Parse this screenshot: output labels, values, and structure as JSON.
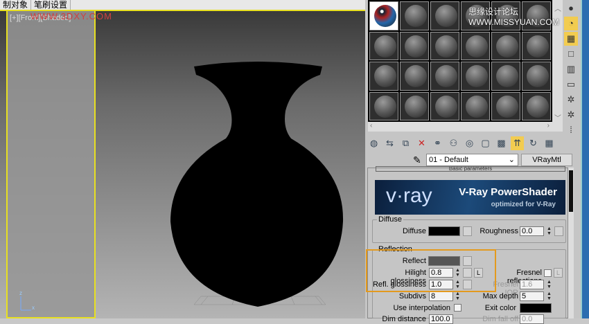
{
  "menubar": {
    "items": [
      "制对象",
      "笔刷设置"
    ]
  },
  "viewport": {
    "label": "[+][Front][Shaded]",
    "watermark": "WWW.3DXY.COM"
  },
  "watermark2": "思缘设计论坛 WWW.MISSYUAN.COM",
  "material_editor": {
    "slot_count": 24,
    "active_slot": 0,
    "side_icons": [
      "sample-type-icon",
      "backlight-icon",
      "background-icon",
      "uv-tiling-icon",
      "video-color-check-icon",
      "make-preview-icon",
      "options-icon",
      "select-by-material-icon",
      "material-map-navigator-icon"
    ],
    "toolbar_icons": [
      "get-material-icon",
      "put-to-scene-icon",
      "assign-to-selection-icon",
      "reset-map-icon",
      "make-unique-icon",
      "put-to-library-icon",
      "material-id-icon",
      "show-map-icon",
      "show-end-result-icon",
      "go-to-parent-icon",
      "go-forward-icon",
      "background-icon"
    ],
    "material_name": "01 - Default",
    "material_type": "VRayMtl",
    "rollout_title": "Basic parameters",
    "banner": {
      "logo": "v·ray",
      "title": "V-Ray PowerShader",
      "subtitle": "optimized for V-Ray"
    },
    "diffuse": {
      "group": "Diffuse",
      "label": "Diffuse",
      "color": "#000000",
      "roughness_label": "Roughness",
      "roughness": "0.0"
    },
    "reflection": {
      "group": "Reflection",
      "reflect_label": "Reflect",
      "reflect_color": "#555555",
      "hilight_label": "Hilight glossiness",
      "hilight": "0.8",
      "lock": "L",
      "refl_gloss_label": "Refl. glossiness",
      "refl_gloss": "1.0",
      "fresnel_label": "Fresnel reflections",
      "fresnel_lock": "L",
      "fresnel_ior_label": "Fresnel IOR",
      "fresnel_ior": "1.6",
      "subdivs_label": "Subdivs",
      "subdivs": "8",
      "max_depth_label": "Max depth",
      "max_depth": "5",
      "interp_label": "Use interpolation",
      "exit_label": "Exit color",
      "exit_color": "#000000",
      "dim_dist_label": "Dim distance",
      "dim_dist": "100.0",
      "dim_falloff_label": "Dim fall off",
      "dim_falloff": "0.0"
    }
  }
}
